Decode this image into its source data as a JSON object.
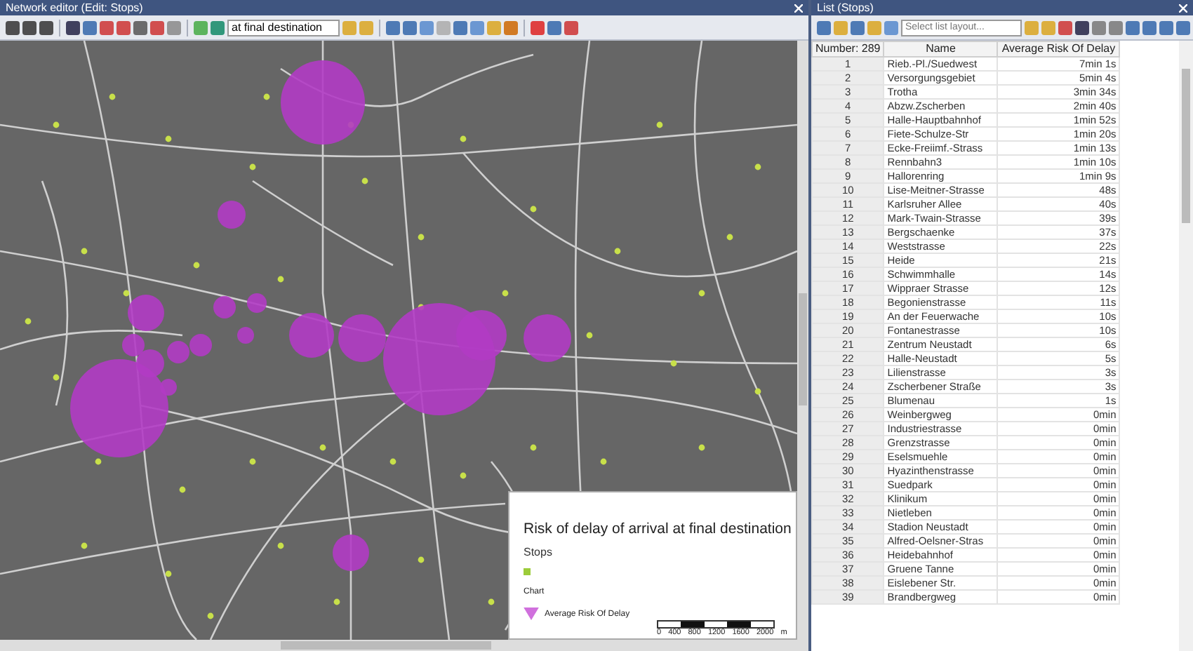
{
  "editor": {
    "title": "Network editor (Edit: Stops)",
    "layer_field": {
      "value": "at final destination"
    }
  },
  "legend": {
    "title": "Risk of delay of arrival at final destination",
    "section": "Stops",
    "chart_label": "Chart",
    "series": "Average Risk Of Delay",
    "scale_labels": [
      "0",
      "400",
      "800",
      "1200",
      "1600",
      "2000"
    ],
    "unit": "m"
  },
  "list": {
    "title": "List (Stops)",
    "layout_field": {
      "placeholder": "Select list layout..."
    },
    "columns": [
      "Number: 289",
      "Name",
      "Average Risk Of Delay"
    ],
    "rows": [
      {
        "number": "1",
        "name": "Rieb.-Pl./Suedwest",
        "value": "7min 1s"
      },
      {
        "number": "2",
        "name": "Versorgungsgebiet",
        "value": "5min 4s"
      },
      {
        "number": "3",
        "name": "Trotha",
        "value": "3min 34s"
      },
      {
        "number": "4",
        "name": "Abzw.Zscherben",
        "value": "2min 40s"
      },
      {
        "number": "5",
        "name": "Halle-Hauptbahnhof",
        "value": "1min 52s"
      },
      {
        "number": "6",
        "name": "Fiete-Schulze-Str",
        "value": "1min 20s"
      },
      {
        "number": "7",
        "name": "Ecke-Freiimf.-Strass",
        "value": "1min 13s"
      },
      {
        "number": "8",
        "name": "Rennbahn3",
        "value": "1min 10s"
      },
      {
        "number": "9",
        "name": "Hallorenring",
        "value": "1min 9s"
      },
      {
        "number": "10",
        "name": "Lise-Meitner-Strasse",
        "value": "48s"
      },
      {
        "number": "11",
        "name": "Karlsruher Allee",
        "value": "40s"
      },
      {
        "number": "12",
        "name": "Mark-Twain-Strasse",
        "value": "39s"
      },
      {
        "number": "13",
        "name": "Bergschaenke",
        "value": "37s"
      },
      {
        "number": "14",
        "name": "Weststrasse",
        "value": "22s"
      },
      {
        "number": "15",
        "name": "Heide",
        "value": "21s"
      },
      {
        "number": "16",
        "name": "Schwimmhalle",
        "value": "14s"
      },
      {
        "number": "17",
        "name": "Wippraer Strasse",
        "value": "12s"
      },
      {
        "number": "18",
        "name": "Begonienstrasse",
        "value": "11s"
      },
      {
        "number": "19",
        "name": "An der Feuerwache",
        "value": "10s"
      },
      {
        "number": "20",
        "name": "Fontanestrasse",
        "value": "10s"
      },
      {
        "number": "21",
        "name": "Zentrum Neustadt",
        "value": "6s"
      },
      {
        "number": "22",
        "name": "Halle-Neustadt",
        "value": "5s"
      },
      {
        "number": "23",
        "name": "Lilienstrasse",
        "value": "3s"
      },
      {
        "number": "24",
        "name": "Zscherbener Straße",
        "value": "3s"
      },
      {
        "number": "25",
        "name": "Blumenau",
        "value": "1s"
      },
      {
        "number": "26",
        "name": "Weinbergweg",
        "value": "0min"
      },
      {
        "number": "27",
        "name": "Industriestrasse",
        "value": "0min"
      },
      {
        "number": "28",
        "name": "Grenzstrasse",
        "value": "0min"
      },
      {
        "number": "29",
        "name": "Eselsmuehle",
        "value": "0min"
      },
      {
        "number": "30",
        "name": "Hyazinthenstrasse",
        "value": "0min"
      },
      {
        "number": "31",
        "name": "Suedpark",
        "value": "0min"
      },
      {
        "number": "32",
        "name": "Klinikum",
        "value": "0min"
      },
      {
        "number": "33",
        "name": "Nietleben",
        "value": "0min"
      },
      {
        "number": "34",
        "name": "Stadion Neustadt",
        "value": "0min"
      },
      {
        "number": "35",
        "name": "Alfred-Oelsner-Stras",
        "value": "0min"
      },
      {
        "number": "36",
        "name": "Heidebahnhof",
        "value": "0min"
      },
      {
        "number": "37",
        "name": "Gruene Tanne",
        "value": "0min"
      },
      {
        "number": "38",
        "name": "Eislebener Str.",
        "value": "0min"
      },
      {
        "number": "39",
        "name": "Brandbergweg",
        "value": "0min"
      }
    ]
  }
}
